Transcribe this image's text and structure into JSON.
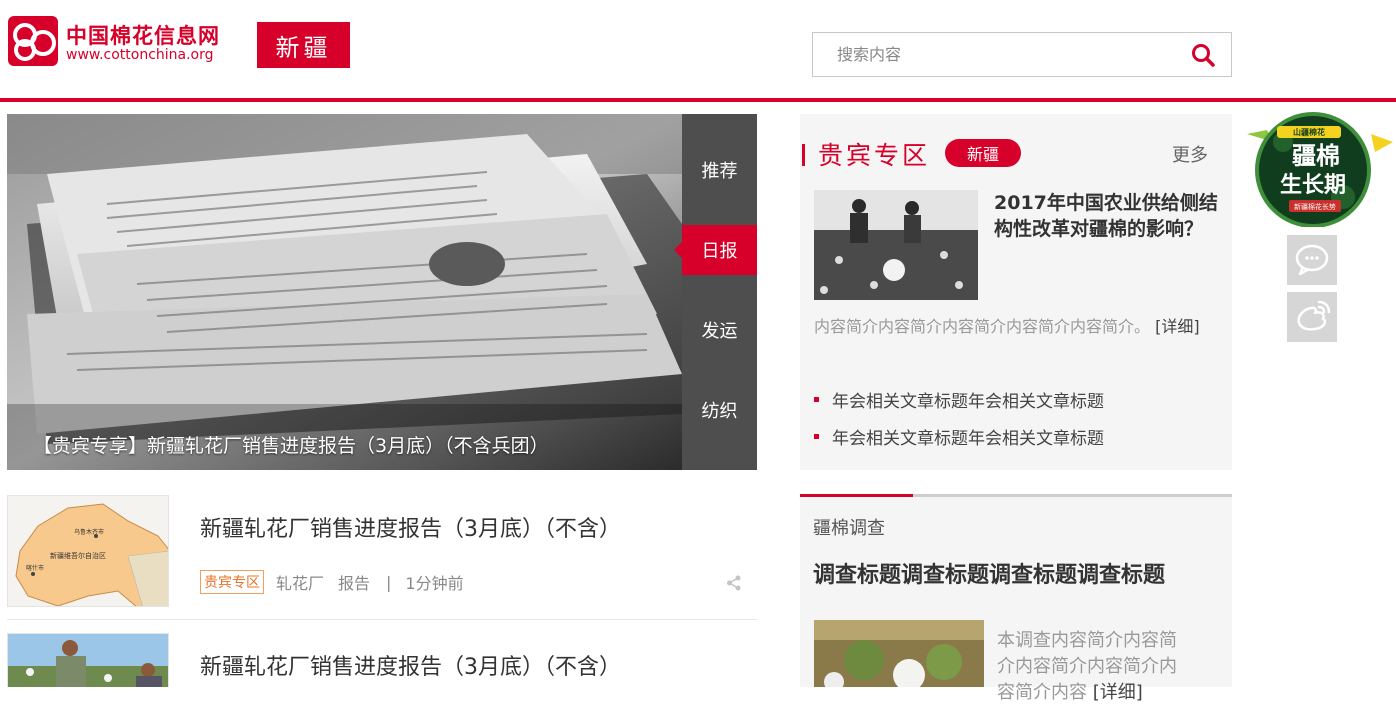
{
  "header": {
    "logo_cn": "中国棉花信息网",
    "logo_en": "www.cottonchina.org",
    "region": "新疆",
    "search_placeholder": "搜索内容"
  },
  "hero": {
    "caption": "【贵宾专享】新疆轧花厂销售进度报告（3月底）（不含兵团）",
    "tabs": [
      {
        "label": "推荐",
        "active": false
      },
      {
        "label": "日报",
        "active": true
      },
      {
        "label": "发运",
        "active": false
      },
      {
        "label": "纺织",
        "active": false
      }
    ]
  },
  "articles": [
    {
      "title": "新疆轧花厂销售进度报告（3月底）（不含）",
      "tag": "贵宾专区",
      "meta1": "轧花厂",
      "meta2": "报告",
      "time": "1分钟前",
      "thumb_text": [
        "乌鲁木齐市",
        "新疆维吾尔自治区",
        "喀什市"
      ]
    },
    {
      "title": "新疆轧花厂销售进度报告（3月底）（不含）"
    }
  ],
  "vip": {
    "title": "贵宾专区",
    "pill": "新疆",
    "more": "更多",
    "headline": "2017年中国农业供给侧结构性改革对疆棉的影响？",
    "summary": "内容简介内容简介内容简介内容简介内容简介。",
    "detail_label": "[详细]",
    "links": [
      "年会相关文章标题年会相关文章标题",
      "年会相关文章标题年会相关文章标题"
    ]
  },
  "survey": {
    "label": "疆棉调查",
    "title": "调查标题调查标题调查标题调查标题",
    "summary": "本调查内容简介内容简介内容简介内容简介内容简介内容",
    "detail_label": "[详细]"
  },
  "side": {
    "badge_small": "山疆棉花",
    "badge_line1": "疆棉",
    "badge_line2": "生长期",
    "badge_footer": "新疆棉花长势"
  },
  "colors": {
    "brand_red": "#d6002a",
    "tab_gray": "#4e4e4e",
    "panel_bg": "#f5f5f5",
    "tag_orange": "#e8742b"
  },
  "icons": {
    "search": "search-icon",
    "share": "share-icon",
    "wechat": "wechat-icon",
    "weibo": "weibo-icon"
  }
}
